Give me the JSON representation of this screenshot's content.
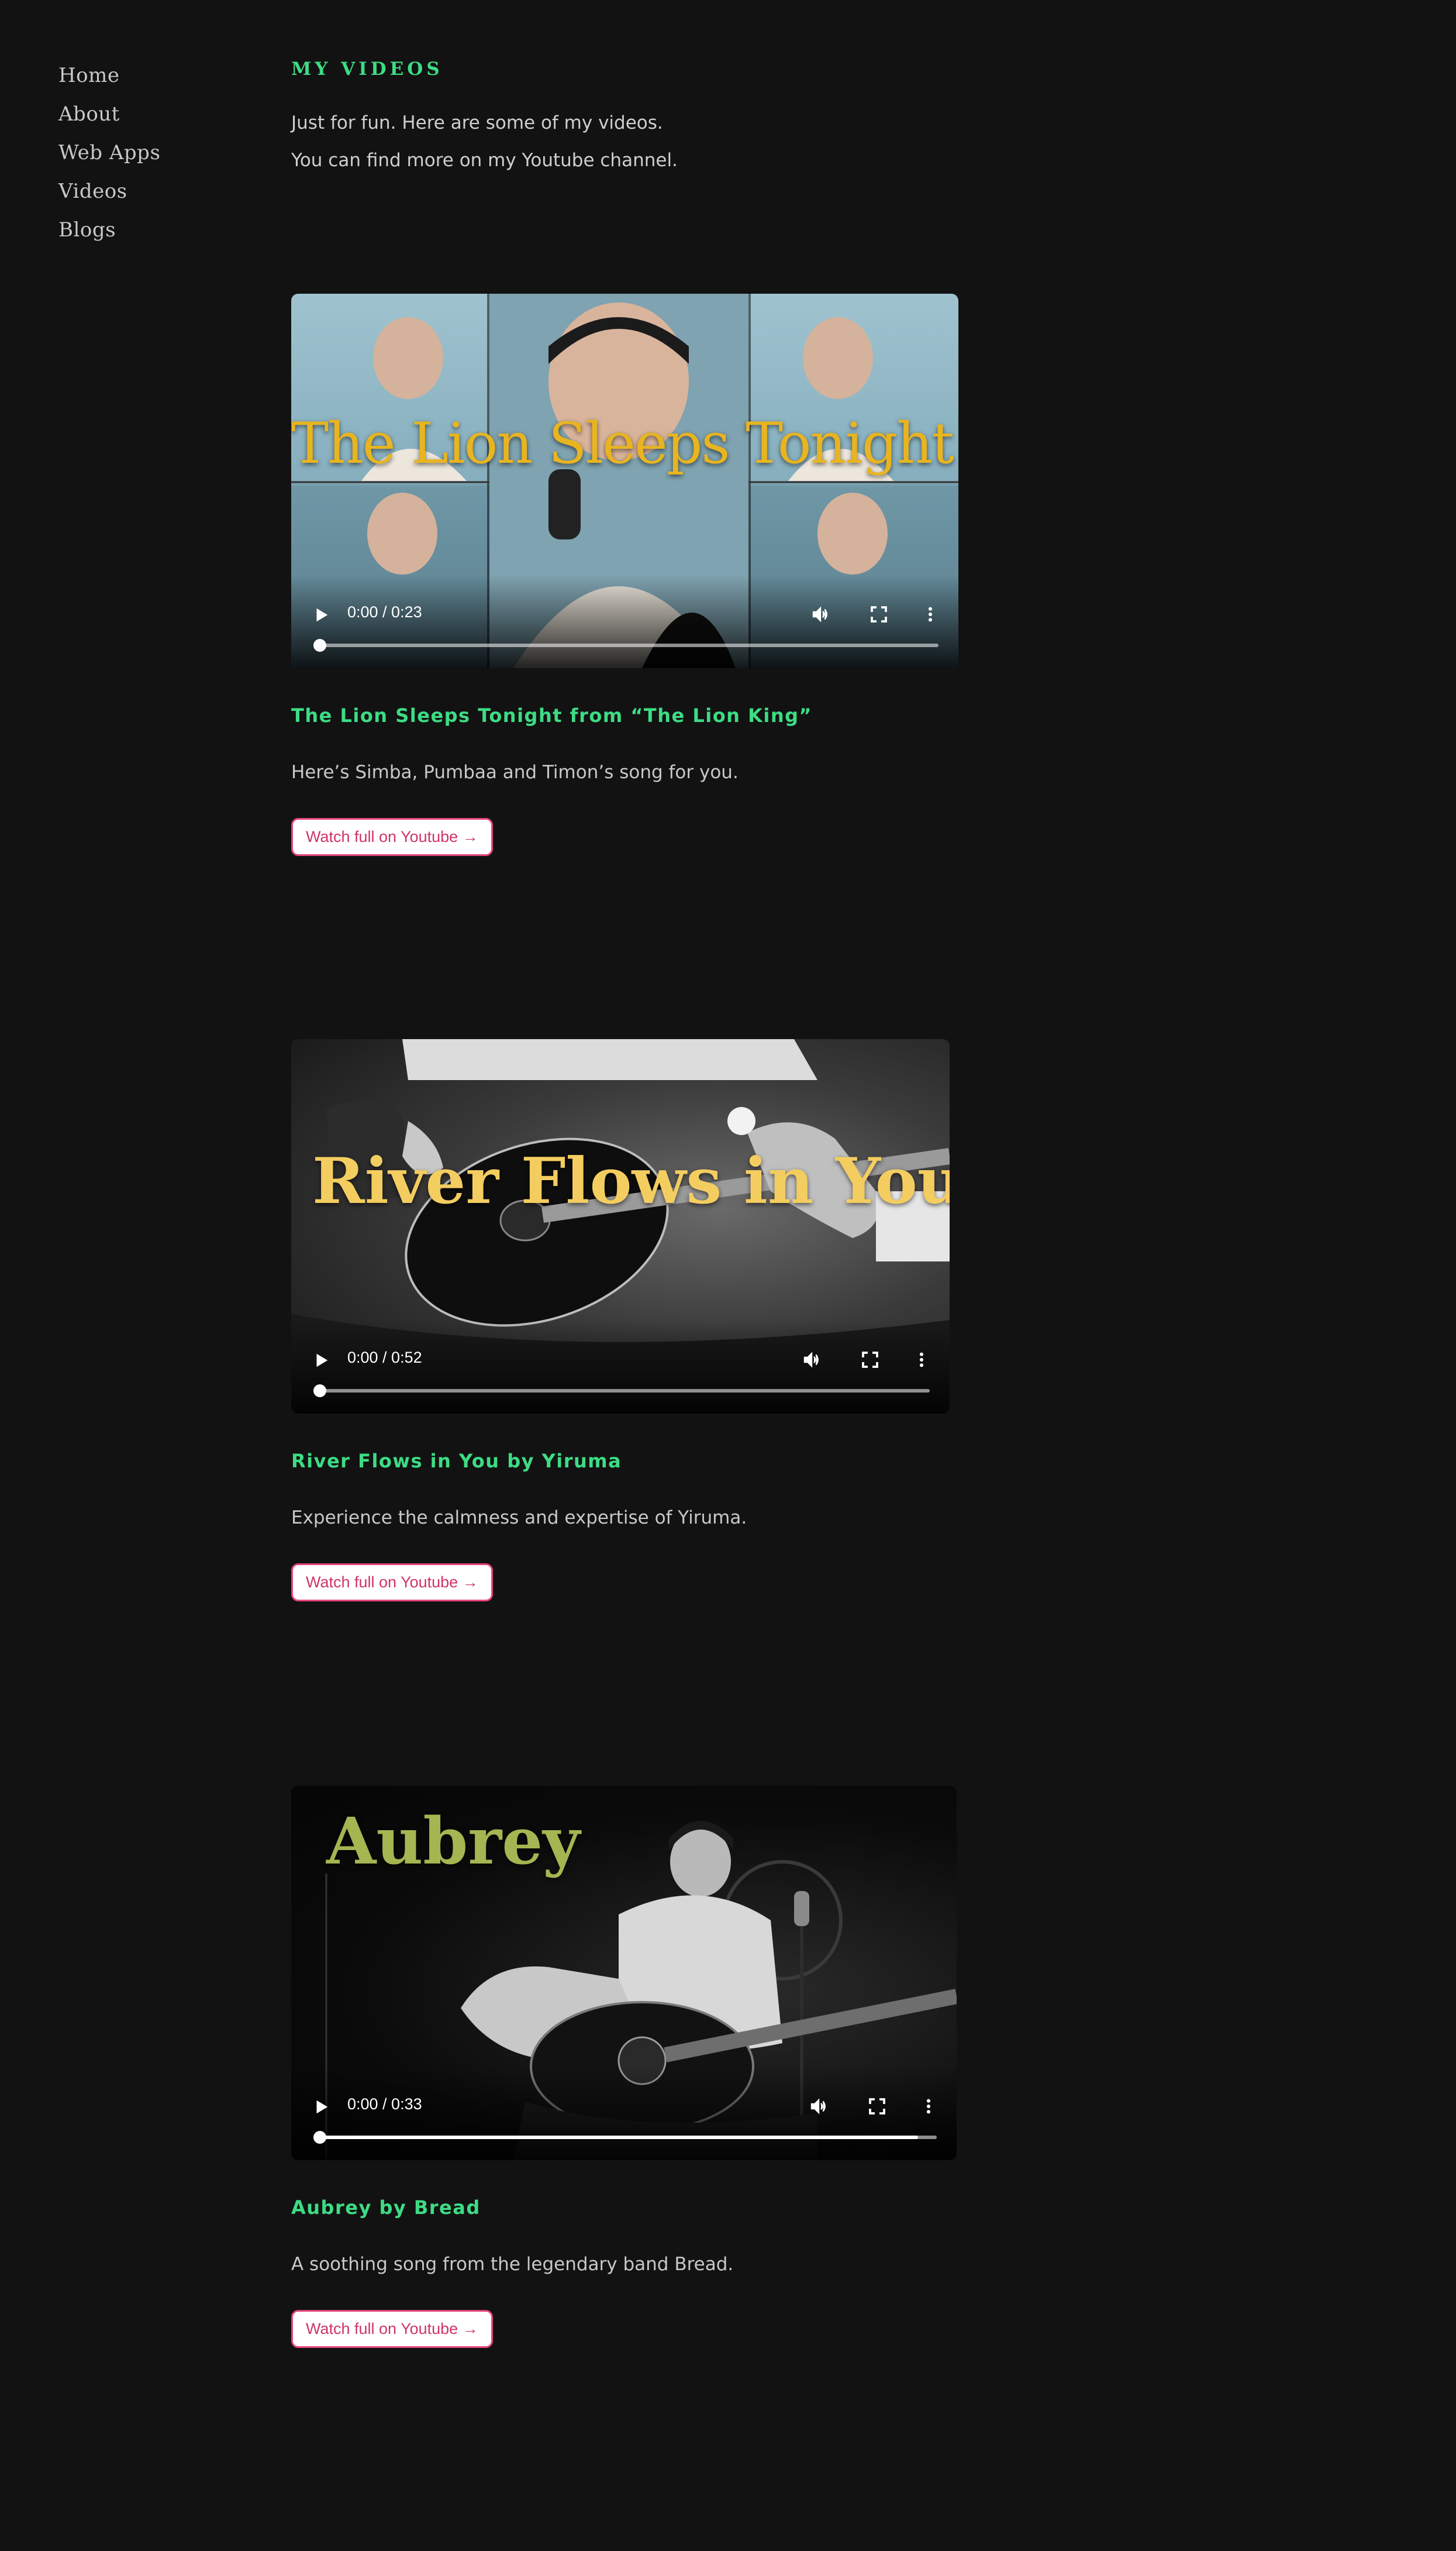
{
  "nav": {
    "items": [
      {
        "label": "Home"
      },
      {
        "label": "About"
      },
      {
        "label": "Web Apps"
      },
      {
        "label": "Videos"
      },
      {
        "label": "Blogs"
      }
    ]
  },
  "page": {
    "title": "MY VIDEOS",
    "intro_line1": "Just for fun. Here are some of my videos.",
    "intro_line2": "You can find more on my Youtube channel."
  },
  "videos": [
    {
      "poster_title": "The Lion Sleeps Tonight",
      "time": "0:00 / 0:23",
      "progress": 0,
      "title": "The Lion Sleeps Tonight from “The Lion King”",
      "description": "Here’s Simba, Pumbaa and Timon’s song for you.",
      "button_label": "Watch full on Youtube →",
      "accent_color": "#e8b420"
    },
    {
      "poster_title": "River Flows in You",
      "time": "0:00 / 0:52",
      "progress": 0,
      "title": "River Flows in You by Yiruma",
      "description": "Experience the calmness and expertise of Yiruma.",
      "button_label": "Watch full on Youtube →",
      "accent_color": "#f4cd60"
    },
    {
      "poster_title": "Aubrey",
      "time": "0:00 / 0:33",
      "progress": 0.97,
      "title": "Aubrey by Bread",
      "description": "A soothing song from the legendary band Bread.",
      "button_label": "Watch full on Youtube →",
      "accent_color": "#a5b551"
    }
  ],
  "colors": {
    "background": "#121212",
    "heading_green": "#3ddc84",
    "button_pink": "#e6457a"
  },
  "icons": {
    "play": "play-icon",
    "volume": "volume-icon",
    "fullscreen": "fullscreen-icon",
    "more": "more-vert-icon"
  }
}
